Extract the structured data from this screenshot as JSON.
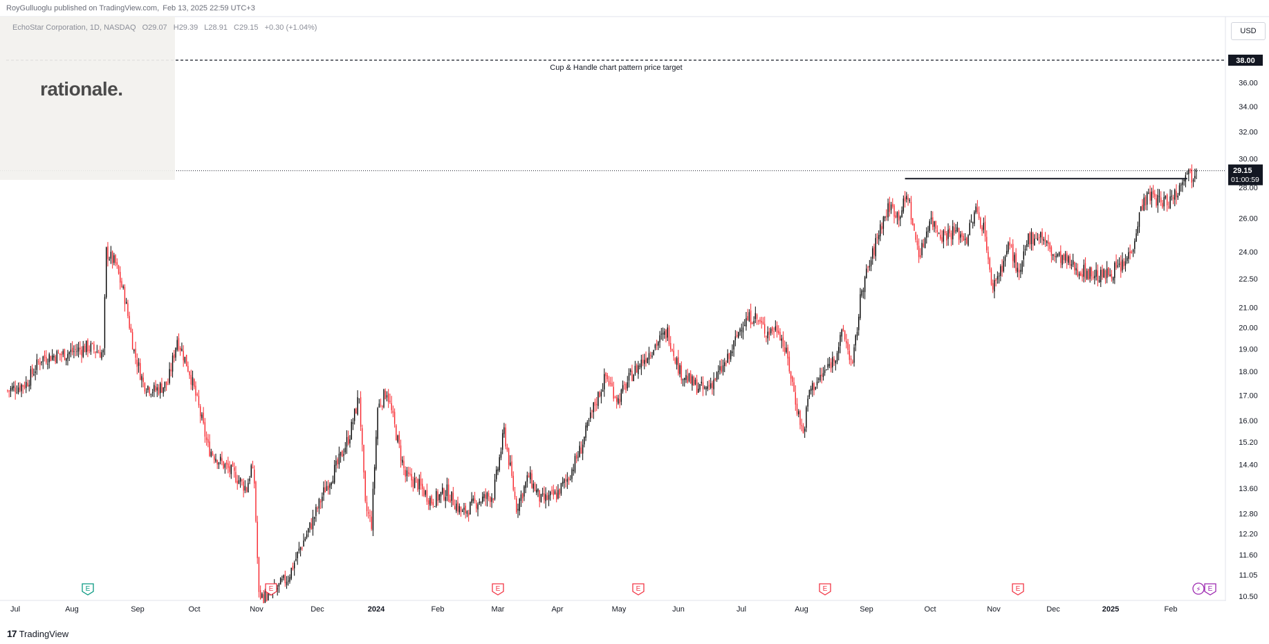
{
  "header": {
    "publisher": "RoyGulluoglu published on TradingView.com,",
    "timestamp": "Feb 13, 2025 22:59 UTC+3"
  },
  "symbol_line": {
    "name": "EchoStar Corporation, 1D, NASDAQ",
    "open": "O29.07",
    "high": "H29.39",
    "low": "L28.91",
    "close": "C29.15",
    "change": "+0.30 (+1.04%)"
  },
  "logo_text": "rationale.",
  "currency_button": "USD",
  "footer": {
    "brand": "TradingView",
    "mark": "17"
  },
  "colors": {
    "up": "#000000",
    "down": "#f7262d",
    "grid": "#f0f3fa",
    "axis_text": "#131722",
    "earnings_red": "#f23645",
    "earnings_teal": "#089981",
    "dividend": "#9c27b0"
  },
  "chart_data": {
    "type": "candlestick",
    "y_scale": "log",
    "ylim": [
      10.5,
      40
    ],
    "price_ticks": [
      "10.50",
      "11.05",
      "11.60",
      "12.20",
      "12.80",
      "13.60",
      "14.40",
      "15.20",
      "16.00",
      "17.00",
      "18.00",
      "19.00",
      "20.00",
      "21.00",
      "22.50",
      "24.00",
      "26.00",
      "28.00",
      "30.00",
      "32.00",
      "34.00",
      "36.00"
    ],
    "time_ticks": [
      "Jul",
      "Aug",
      "Sep",
      "Oct",
      "Nov",
      "Dec",
      "2024",
      "Feb",
      "Mar",
      "Apr",
      "May",
      "Jun",
      "Jul",
      "Aug",
      "Sep",
      "Oct",
      "Nov",
      "Dec",
      "2025",
      "Feb"
    ],
    "bold_ticks": [
      "2024",
      "2025"
    ],
    "current_price": {
      "value": "29.15",
      "countdown": "01:00:59"
    },
    "target": {
      "value": "38.00",
      "label": "Cup & Handle chart pattern price target"
    },
    "resistance_level": 28.6,
    "earnings_markers": [
      {
        "label": "E",
        "month": "Aug",
        "color": "teal"
      },
      {
        "label": "E",
        "month": "Nov",
        "color": "red"
      },
      {
        "label": "E",
        "month": "Mar",
        "color": "red"
      },
      {
        "label": "E",
        "month": "May",
        "color": "red"
      },
      {
        "label": "E",
        "month": "Aug",
        "color": "red"
      },
      {
        "label": "E",
        "month": "Nov",
        "color": "red"
      },
      {
        "label": "E",
        "month": "Feb",
        "color": "purple"
      }
    ],
    "dividend_markers": [
      {
        "label": "⚡",
        "month": "Feb"
      }
    ],
    "price_path": [
      [
        0,
        17.2
      ],
      [
        12,
        17.5
      ],
      [
        22,
        18.6
      ],
      [
        38,
        18.8
      ],
      [
        52,
        19.1
      ],
      [
        62,
        18.8
      ],
      [
        64,
        24.0
      ],
      [
        70,
        23.3
      ],
      [
        76,
        21.5
      ],
      [
        82,
        18.9
      ],
      [
        88,
        17.5
      ],
      [
        95,
        17.2
      ],
      [
        104,
        17.5
      ],
      [
        110,
        19.5
      ],
      [
        118,
        18.0
      ],
      [
        124,
        16.5
      ],
      [
        130,
        15.0
      ],
      [
        138,
        14.5
      ],
      [
        148,
        14.0
      ],
      [
        155,
        13.6
      ],
      [
        158,
        14.3
      ],
      [
        160,
        13.8
      ],
      [
        163,
        10.5
      ],
      [
        170,
        10.5
      ],
      [
        182,
        11.0
      ],
      [
        190,
        11.8
      ],
      [
        198,
        12.6
      ],
      [
        206,
        13.6
      ],
      [
        214,
        14.4
      ],
      [
        222,
        15.5
      ],
      [
        228,
        17.0
      ],
      [
        232,
        13.0
      ],
      [
        236,
        12.5
      ],
      [
        240,
        16.5
      ],
      [
        246,
        17.2
      ],
      [
        252,
        15.5
      ],
      [
        258,
        14.0
      ],
      [
        265,
        13.8
      ],
      [
        275,
        13.2
      ],
      [
        285,
        13.5
      ],
      [
        295,
        12.8
      ],
      [
        305,
        13.2
      ],
      [
        315,
        13.4
      ],
      [
        322,
        15.6
      ],
      [
        330,
        13.0
      ],
      [
        338,
        14.0
      ],
      [
        346,
        13.2
      ],
      [
        356,
        13.4
      ],
      [
        364,
        14.0
      ],
      [
        372,
        15.0
      ],
      [
        380,
        16.5
      ],
      [
        388,
        17.8
      ],
      [
        396,
        16.8
      ],
      [
        404,
        17.8
      ],
      [
        412,
        18.5
      ],
      [
        420,
        19.2
      ],
      [
        428,
        19.8
      ],
      [
        436,
        18.0
      ],
      [
        444,
        17.5
      ],
      [
        452,
        17.2
      ],
      [
        460,
        17.8
      ],
      [
        468,
        18.6
      ],
      [
        476,
        20.2
      ],
      [
        484,
        20.6
      ],
      [
        492,
        19.8
      ],
      [
        500,
        20.0
      ],
      [
        506,
        18.5
      ],
      [
        512,
        16.5
      ],
      [
        516,
        15.5
      ],
      [
        520,
        17.2
      ],
      [
        528,
        17.8
      ],
      [
        536,
        18.6
      ],
      [
        542,
        19.8
      ],
      [
        548,
        18.2
      ],
      [
        554,
        22.0
      ],
      [
        560,
        23.5
      ],
      [
        566,
        25.5
      ],
      [
        572,
        26.8
      ],
      [
        578,
        26.2
      ],
      [
        584,
        27.5
      ],
      [
        588,
        25.0
      ],
      [
        592,
        23.8
      ],
      [
        598,
        26.0
      ],
      [
        606,
        25.0
      ],
      [
        614,
        25.2
      ],
      [
        622,
        24.8
      ],
      [
        628,
        26.5
      ],
      [
        634,
        25.2
      ],
      [
        638,
        22.0
      ],
      [
        644,
        23.0
      ],
      [
        650,
        24.5
      ],
      [
        656,
        22.5
      ],
      [
        662,
        24.8
      ],
      [
        670,
        25.0
      ],
      [
        678,
        23.8
      ],
      [
        686,
        23.5
      ],
      [
        694,
        23.0
      ],
      [
        702,
        22.8
      ],
      [
        710,
        22.6
      ],
      [
        718,
        23.0
      ],
      [
        724,
        23.2
      ],
      [
        730,
        24.5
      ],
      [
        736,
        27.0
      ],
      [
        742,
        27.5
      ],
      [
        748,
        27.0
      ],
      [
        754,
        27.2
      ],
      [
        760,
        28.0
      ],
      [
        764,
        29.3
      ],
      [
        768,
        28.8
      ],
      [
        771,
        29.15
      ]
    ]
  }
}
